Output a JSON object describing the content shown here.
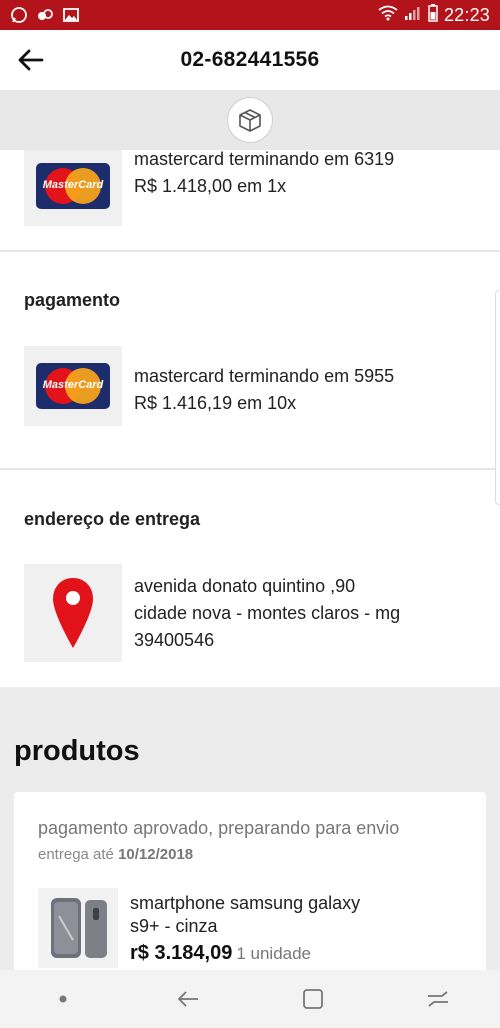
{
  "status_bar": {
    "time": "22:23",
    "left_icons": [
      "whatsapp-icon",
      "app-icon",
      "gallery-icon"
    ],
    "right_icons": [
      "wifi-icon",
      "signal-icon",
      "battery-icon"
    ]
  },
  "header": {
    "title": "02-682441556",
    "back_icon": "back-arrow-icon"
  },
  "strip": {
    "icon": "box-icon"
  },
  "payments": [
    {
      "card_text": "mastercard terminando em 6319",
      "amount_text": "R$ 1.418,00 em 1x",
      "brand": "MasterCard"
    },
    {
      "card_text": "mastercard terminando em 5955",
      "amount_text": "R$ 1.416,19 em 10x",
      "brand": "MasterCard"
    }
  ],
  "payment_section_title": "pagamento",
  "address_section": {
    "title": "endereço de entrega",
    "line1": "avenida donato quintino ,90",
    "line2": "cidade nova - montes claros - mg",
    "line3": "39400546"
  },
  "products": {
    "title": "produtos",
    "status": "pagamento aprovado, preparando para envio",
    "delivery_label": "entrega até",
    "delivery_date": "10/12/2018",
    "item_name_line1": "smartphone samsung galaxy",
    "item_name_line2": "s9+ - cinza",
    "item_price": "r$ 3.184,09",
    "item_qty": "1 unidade"
  },
  "colors": {
    "status_bar": "#b3141b",
    "pin_red": "#e1121a",
    "mastercard_bg": "#1d2d6b"
  }
}
